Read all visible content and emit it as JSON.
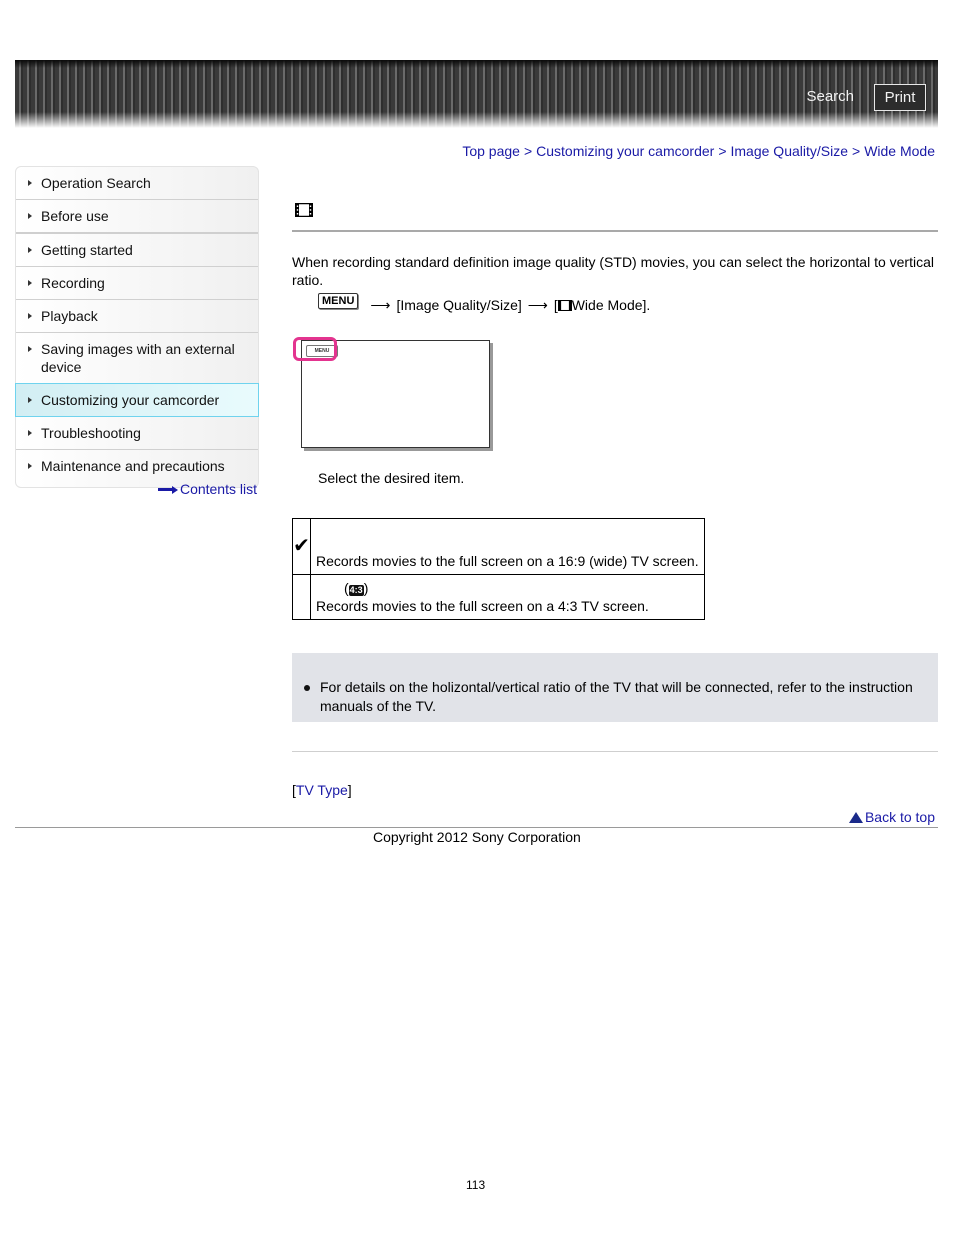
{
  "header": {
    "search_label": "Search",
    "print_label": "Print"
  },
  "breadcrumb": [
    {
      "label": "Top page"
    },
    {
      "label": "Customizing your camcorder"
    },
    {
      "label": "Image Quality/Size"
    },
    {
      "label": "Wide Mode"
    }
  ],
  "breadcrumb_separator": ">",
  "sidebar": {
    "items": [
      {
        "label": "Operation Search"
      },
      {
        "label": "Before use"
      },
      {
        "label": "Getting started"
      },
      {
        "label": "Recording"
      },
      {
        "label": "Playback"
      },
      {
        "label": "Saving images with an external device"
      },
      {
        "label": "Customizing your camcorder",
        "active": true
      },
      {
        "label": "Troubleshooting"
      },
      {
        "label": "Maintenance and precautions"
      }
    ],
    "contents_link": "Contents list"
  },
  "main": {
    "title_icon": "film-icon",
    "intro": "When recording standard definition image quality (STD) movies, you can select the horizontal to vertical ratio.",
    "menu_path": {
      "menu_button": "MENU",
      "step1": "[Image Quality/Size]",
      "step2_prefix": "[",
      "step2": "Wide Mode].",
      "arrow": "⟶"
    },
    "illustration": {
      "menu_button": "MENU"
    },
    "step_text": "Select the desired item.",
    "options": [
      {
        "selected": true,
        "name": "",
        "description": "Records movies to the full screen on a 16:9 (wide) TV screen."
      },
      {
        "selected": false,
        "name_prefix": "(",
        "name_icon": "4:3",
        "name_suffix": ")",
        "description": "Records movies to the full screen on a 4:3 TV screen."
      }
    ],
    "check_mark": "✔",
    "note": "For details on the holizontal/vertical ratio of the TV that will be connected, refer to the instruction manuals of the TV.",
    "related": {
      "open": "[",
      "label": "TV Type",
      "close": "]"
    },
    "back_to_top": "Back to top"
  },
  "footer": {
    "copyright": "Copyright 2012 Sony Corporation",
    "page_number": "113"
  },
  "colors": {
    "link": "#1a1aa6",
    "active_nav_border": "#6fd3ee",
    "highlight": "#e3348f",
    "note_bg": "#e1e3e8"
  }
}
